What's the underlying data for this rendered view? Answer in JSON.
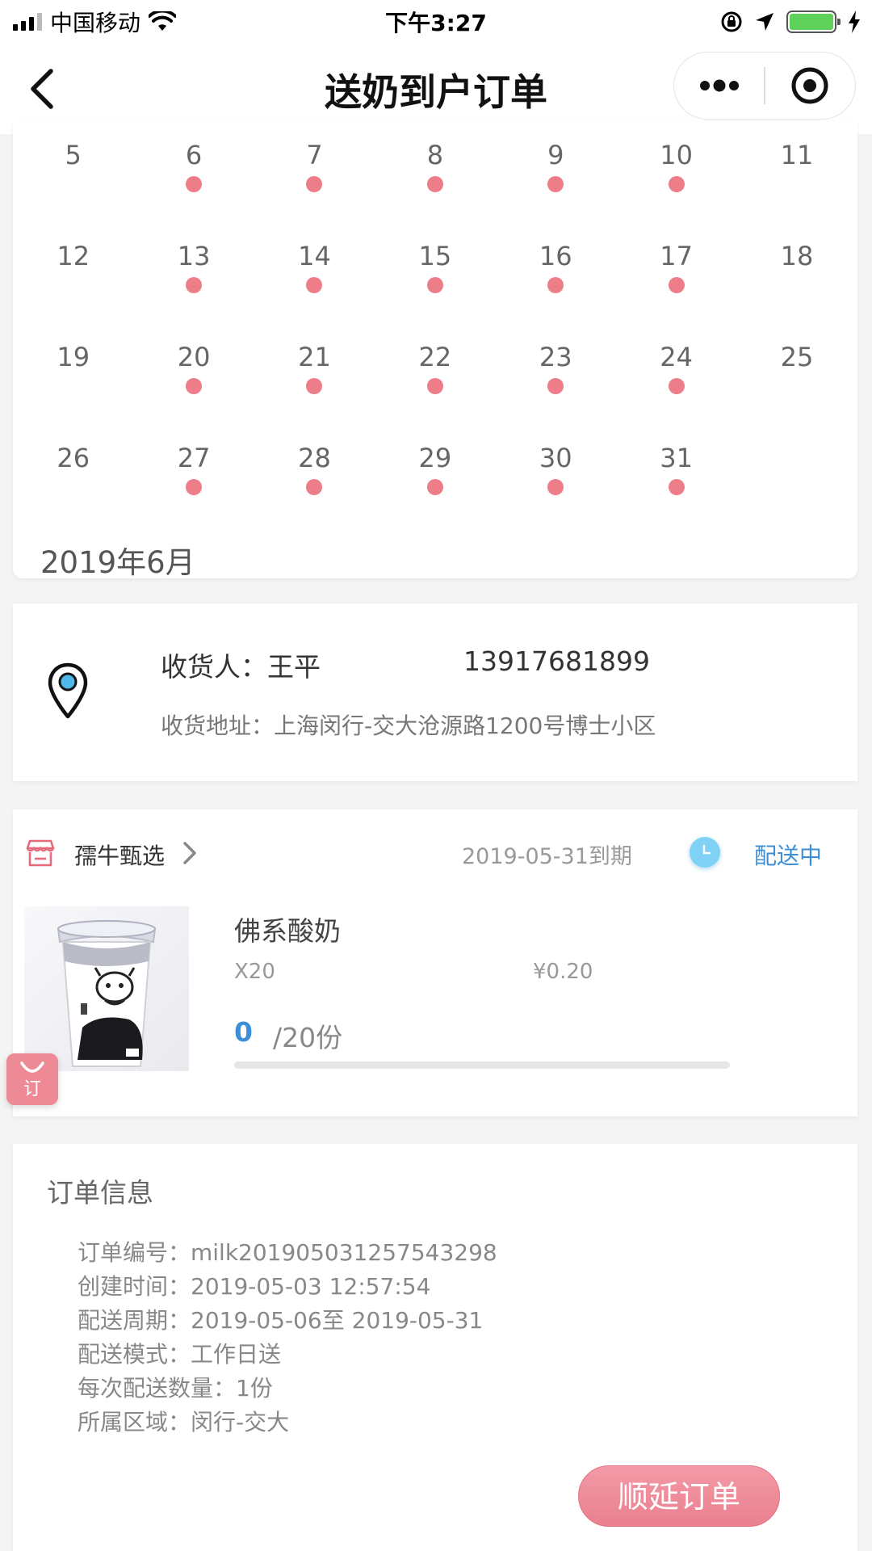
{
  "status_bar": {
    "carrier": "中国移动",
    "time": "下午3:27"
  },
  "nav": {
    "title": "送奶到户订单"
  },
  "calendar": {
    "rows": [
      [
        {
          "day": "5",
          "dot": false
        },
        {
          "day": "6",
          "dot": true
        },
        {
          "day": "7",
          "dot": true
        },
        {
          "day": "8",
          "dot": true
        },
        {
          "day": "9",
          "dot": true
        },
        {
          "day": "10",
          "dot": true
        },
        {
          "day": "11",
          "dot": false
        }
      ],
      [
        {
          "day": "12",
          "dot": false
        },
        {
          "day": "13",
          "dot": true
        },
        {
          "day": "14",
          "dot": true
        },
        {
          "day": "15",
          "dot": true
        },
        {
          "day": "16",
          "dot": true
        },
        {
          "day": "17",
          "dot": true
        },
        {
          "day": "18",
          "dot": false
        }
      ],
      [
        {
          "day": "19",
          "dot": false
        },
        {
          "day": "20",
          "dot": true
        },
        {
          "day": "21",
          "dot": true
        },
        {
          "day": "22",
          "dot": true
        },
        {
          "day": "23",
          "dot": true
        },
        {
          "day": "24",
          "dot": true
        },
        {
          "day": "25",
          "dot": false
        }
      ],
      [
        {
          "day": "26",
          "dot": false
        },
        {
          "day": "27",
          "dot": true
        },
        {
          "day": "28",
          "dot": true
        },
        {
          "day": "29",
          "dot": true
        },
        {
          "day": "30",
          "dot": true
        },
        {
          "day": "31",
          "dot": true
        },
        {
          "day": "",
          "dot": false
        }
      ]
    ],
    "next_month": "2019年6月",
    "dot_color": "#ee7d8a"
  },
  "address": {
    "receiver": "收货人：王平",
    "phone": "13917681899",
    "address": "收货地址：上海闵行-交大沧源路1200号博士小区"
  },
  "order": {
    "store_name": "孺牛甄选",
    "expire": "2019-05-31到期",
    "status": "配送中",
    "product_name": "佛系酸奶",
    "quantity": "X20",
    "price": "¥0.20",
    "delivered": "0",
    "total": "/20份",
    "progress_fraction": 0,
    "badge": "订"
  },
  "order_info": {
    "title": "订单信息",
    "rows": [
      "订单编号：milk201905031257543298",
      "创建时间：2019-05-03 12:57:54",
      "配送周期：2019-05-06至 2019-05-31",
      "配送模式：工作日送",
      "每次配送数量：1份",
      "所属区域：闵行-交大"
    ]
  },
  "actions": {
    "extend_label": "顺延订单"
  },
  "colors": {
    "accent_pink": "#ee7d8a",
    "accent_blue": "#3c8fd6"
  }
}
